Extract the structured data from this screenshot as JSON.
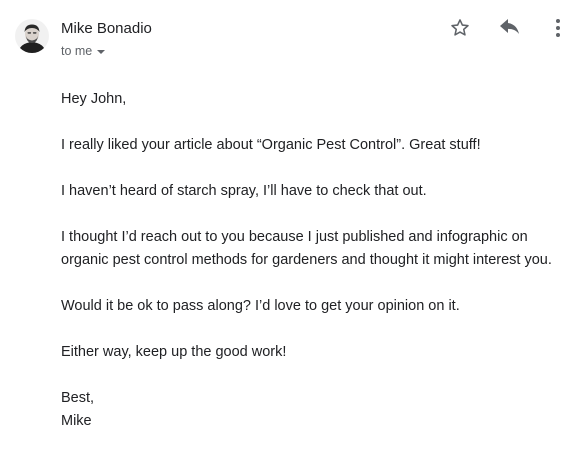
{
  "message": {
    "sender": {
      "name": "Mike Bonadio",
      "avatar_icon": "person-photo-avatar"
    },
    "recipient_label": "to me",
    "actions": {
      "star_icon": "star-outline-icon",
      "reply_icon": "reply-arrow-icon",
      "more_icon": "vertical-dots-icon"
    },
    "body": {
      "greeting": "Hey John,",
      "paragraphs": [
        "I really liked your article about “Organic Pest Control”. Great stuff!",
        "I haven’t heard of starch spray, I’ll have to check that out.",
        "I thought I’d reach out to you because I just published and infographic on organic pest control methods for gardeners and thought it might interest you.",
        "Would it be ok to pass along? I’d love to get your opinion on it.",
        "Either way, keep up the good work!"
      ],
      "signoff": "Best,",
      "signature": "Mike"
    }
  },
  "colors": {
    "text": "#202124",
    "secondary_text": "#5f6368",
    "icon": "#5f6368"
  }
}
